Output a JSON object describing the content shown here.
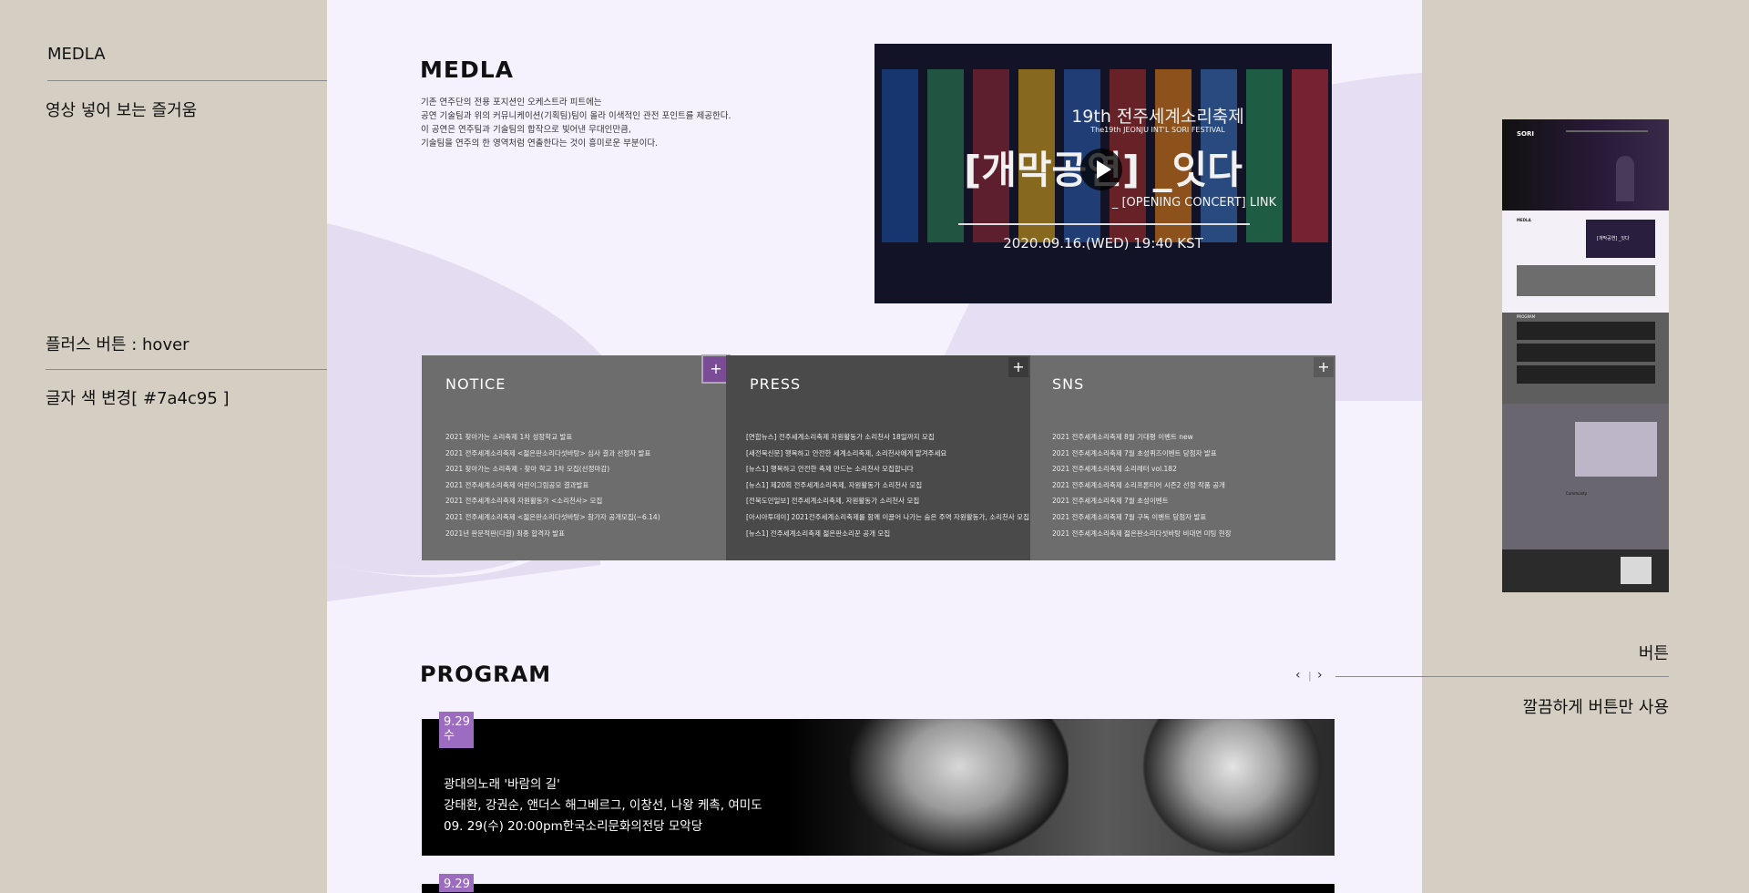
{
  "annotations": {
    "media_title": "MEDLA",
    "media_desc": "영상 넣어 보는 즐거움",
    "plus_title": "플러스 버튼 : hover",
    "plus_desc": "글자 색 변경[ #7a4c95 ]",
    "button_title": "버튼",
    "button_desc": "깔끔하게 버튼만 사용"
  },
  "media": {
    "title": "MEDLA",
    "desc": [
      "기존 연주단의 전용 포지션인 오케스트라 피트에는",
      "공연 기술팀과 위의 커뮤니케이션(기획팀)팀이 올라 이색적인 관전 포인트를 제공한다.",
      "이 공연은 연주팀과 기술팀의 합작으로 빚어낸 무대인만큼,",
      "기술팀을 연주의 한 영역처럼 연출한다는 것이 흥미로운 부분이다."
    ],
    "video": {
      "line1": "19th 전주세계소리축제",
      "line2": "The19th JEONJU INT'L SORI FESTIVAL",
      "headline": "[개막공연] _잇다",
      "sub": "_ [OPENING CONCERT] LINK",
      "date": "2020.09.16.(WED) 19:40 KST"
    }
  },
  "boards": [
    {
      "title": "NOTICE",
      "plus": "+",
      "items": [
        "2021 찾아가는 소리축제 1차 성장학교 발표",
        "2021 전주세계소리축제 <젊은판소리다섯바탕> 심사 결과 선정자 발표",
        "2021 찾아가는 소리축제 - 찾아 학교 1차 모집(선정마감)",
        "2021 전주세계소리축제 어린이그림공모 결과발표",
        "2021 전주세계소리축제 자원활동가 <소리천사> 모집",
        "2021 전주세계소리축제 <젊은판소리다섯바탕> 참가자 공개모집(~6.14)",
        "2021년 판문적판(다결) 최종 합격자 발표"
      ]
    },
    {
      "title": "PRESS",
      "plus": "+",
      "items": [
        "[연합뉴스] 전주세계소리축제 자원활동가 소리천사 18일까지 모집",
        "[새전북신문] 행복하고 안전한 세계소리축제, 소리천사에게 맡겨주세요",
        "[뉴스1] 행복하고 안전한 축제 만드는 소리천사 모집합니다",
        "[뉴스1] 제20회 전주세계소리축제, 자원활동가 소리천사 모집",
        "[전북도민일보] 전주세계소리축제, 자원활동가 소리천사 모집",
        "[아시아투데이] 2021전주세계소리축제를 함께 이끌어 나가는 숨은 주역 자원활동가, 소리천사 모집",
        "[뉴스1] 전주세계소리축제 젊은판소리꾼 공개 모집"
      ]
    },
    {
      "title": "SNS",
      "plus": "+",
      "items": [
        "2021 전주세계소리축제 8월 기대평 이벤트 new",
        "2021 전주세계소리축제 7월 초성퀴즈이벤트 당첨자 발표",
        "2021 전주세계소리축제 소리레터 vol.182",
        "2021 전주세계소리축제 소리프론티어 시즌2 선정 작품 공개",
        "2021 전주세계소리축제 7월 초성이벤트",
        "2021 전주세계소리축제 7월 구독 이벤트 당첨자 발표",
        "2021 전주세계소리축제 젊은판소리다섯바탕 비대면 미팅 현장"
      ]
    }
  ],
  "program": {
    "title": "PROGRAM",
    "prev": "‹",
    "divider": "|",
    "next": "›",
    "cards": [
      {
        "date": "9.29",
        "day": "수",
        "title": "광대의노래 '바람의 길'",
        "performers": "강태환, 강권순, 앤더스 해그베르그, 이창선, 나왕 케촉, 여미도",
        "time_place": "09. 29(수) 20:00pm한국소리문화의전당 모악당"
      },
      {
        "date": "9.29",
        "day": "",
        "title": "",
        "performers": "",
        "time_place": ""
      }
    ]
  },
  "thumbnail": {
    "media_label": "MEDLA",
    "video_label": "[개막공연] _잇다",
    "program_label": "PROGRAM",
    "community_label": "Community",
    "logo": "SORI"
  },
  "colors": {
    "hover_purple": "#7a4c95",
    "badge_purple": "#9c6cc0",
    "board_bg": "#f6f2fd",
    "outer_bg": "#d5cfc3"
  },
  "icons": {
    "play": "play-icon",
    "plus": "plus-icon",
    "prev": "chevron-left-icon",
    "next": "chevron-right-icon"
  }
}
